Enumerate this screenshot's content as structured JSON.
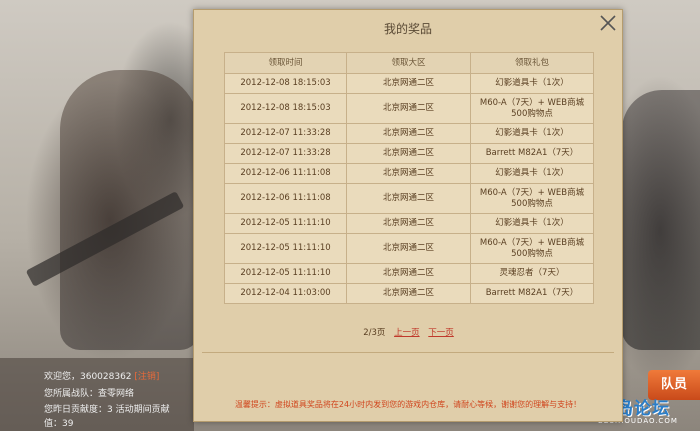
{
  "dialog": {
    "title": "我的奖品",
    "columns": [
      "领取时间",
      "领取大区",
      "领取礼包"
    ],
    "rows": [
      {
        "time": "2012-12-08 18:15:03",
        "region": "北京网通二区",
        "gift": "幻影道具卡（1次）"
      },
      {
        "time": "2012-12-08 18:15:03",
        "region": "北京网通二区",
        "gift": "M60-A（7天）+ WEB商城500购物点"
      },
      {
        "time": "2012-12-07 11:33:28",
        "region": "北京网通二区",
        "gift": "幻影道具卡（1次）"
      },
      {
        "time": "2012-12-07 11:33:28",
        "region": "北京网通二区",
        "gift": "Barrett M82A1（7天）"
      },
      {
        "time": "2012-12-06 11:11:08",
        "region": "北京网通二区",
        "gift": "幻影道具卡（1次）"
      },
      {
        "time": "2012-12-06 11:11:08",
        "region": "北京网通二区",
        "gift": "M60-A（7天）+ WEB商城500购物点"
      },
      {
        "time": "2012-12-05 11:11:10",
        "region": "北京网通二区",
        "gift": "幻影道具卡（1次）"
      },
      {
        "time": "2012-12-05 11:11:10",
        "region": "北京网通二区",
        "gift": "M60-A（7天）+ WEB商城500购物点"
      },
      {
        "time": "2012-12-05 11:11:10",
        "region": "北京网通二区",
        "gift": "灵魂忍者（7天）"
      },
      {
        "time": "2012-12-04 11:03:00",
        "region": "北京网通二区",
        "gift": "Barrett M82A1（7天）"
      }
    ],
    "pager": {
      "page": "2/3页",
      "prev": "上一页",
      "next": "下一页"
    },
    "notice": "温馨提示：虚拟道具奖品将在24小时内发到您的游戏内仓库，请耐心等候，谢谢您的理解与支持！"
  },
  "user": {
    "welcome": "欢迎您，360028362",
    "logout": "[注销]",
    "team": "您所属战队：查零网络",
    "contribution": "您昨日贡献度：3 活动期间贡献",
    "value": "值：39"
  },
  "side_button": "队员",
  "watermark": {
    "title": "猴岛论坛",
    "sub": "BBS.HOUDAO.COM"
  }
}
